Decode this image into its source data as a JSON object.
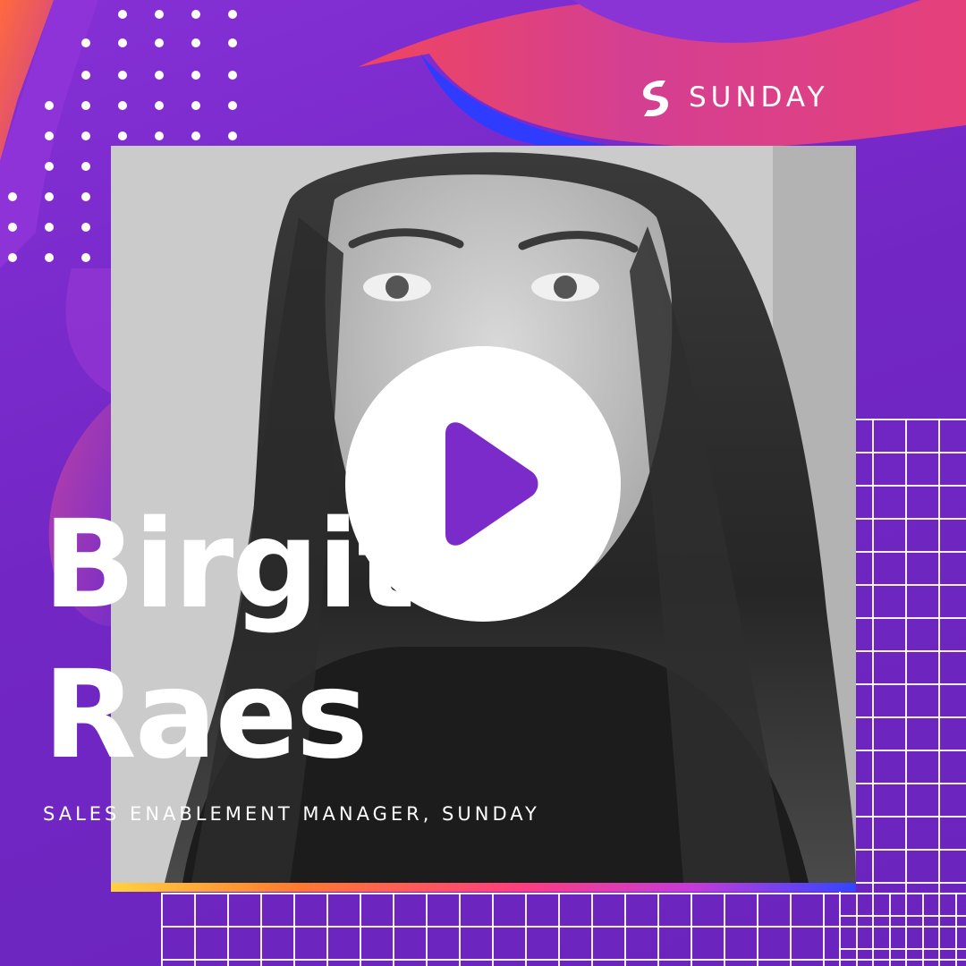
{
  "brand": {
    "name": "SUNDAY",
    "logo_icon": "sunday-s-icon",
    "colors": {
      "background": "#7628c8",
      "accent_pink": "#e8407f",
      "accent_blue": "#2f3cff",
      "text": "#ffffff"
    }
  },
  "person": {
    "first_name": "Birgit",
    "last_name": "Raes",
    "title": "SALES ENABLEMENT MANAGER, SUNDAY"
  },
  "media": {
    "play_icon": "play-icon"
  }
}
